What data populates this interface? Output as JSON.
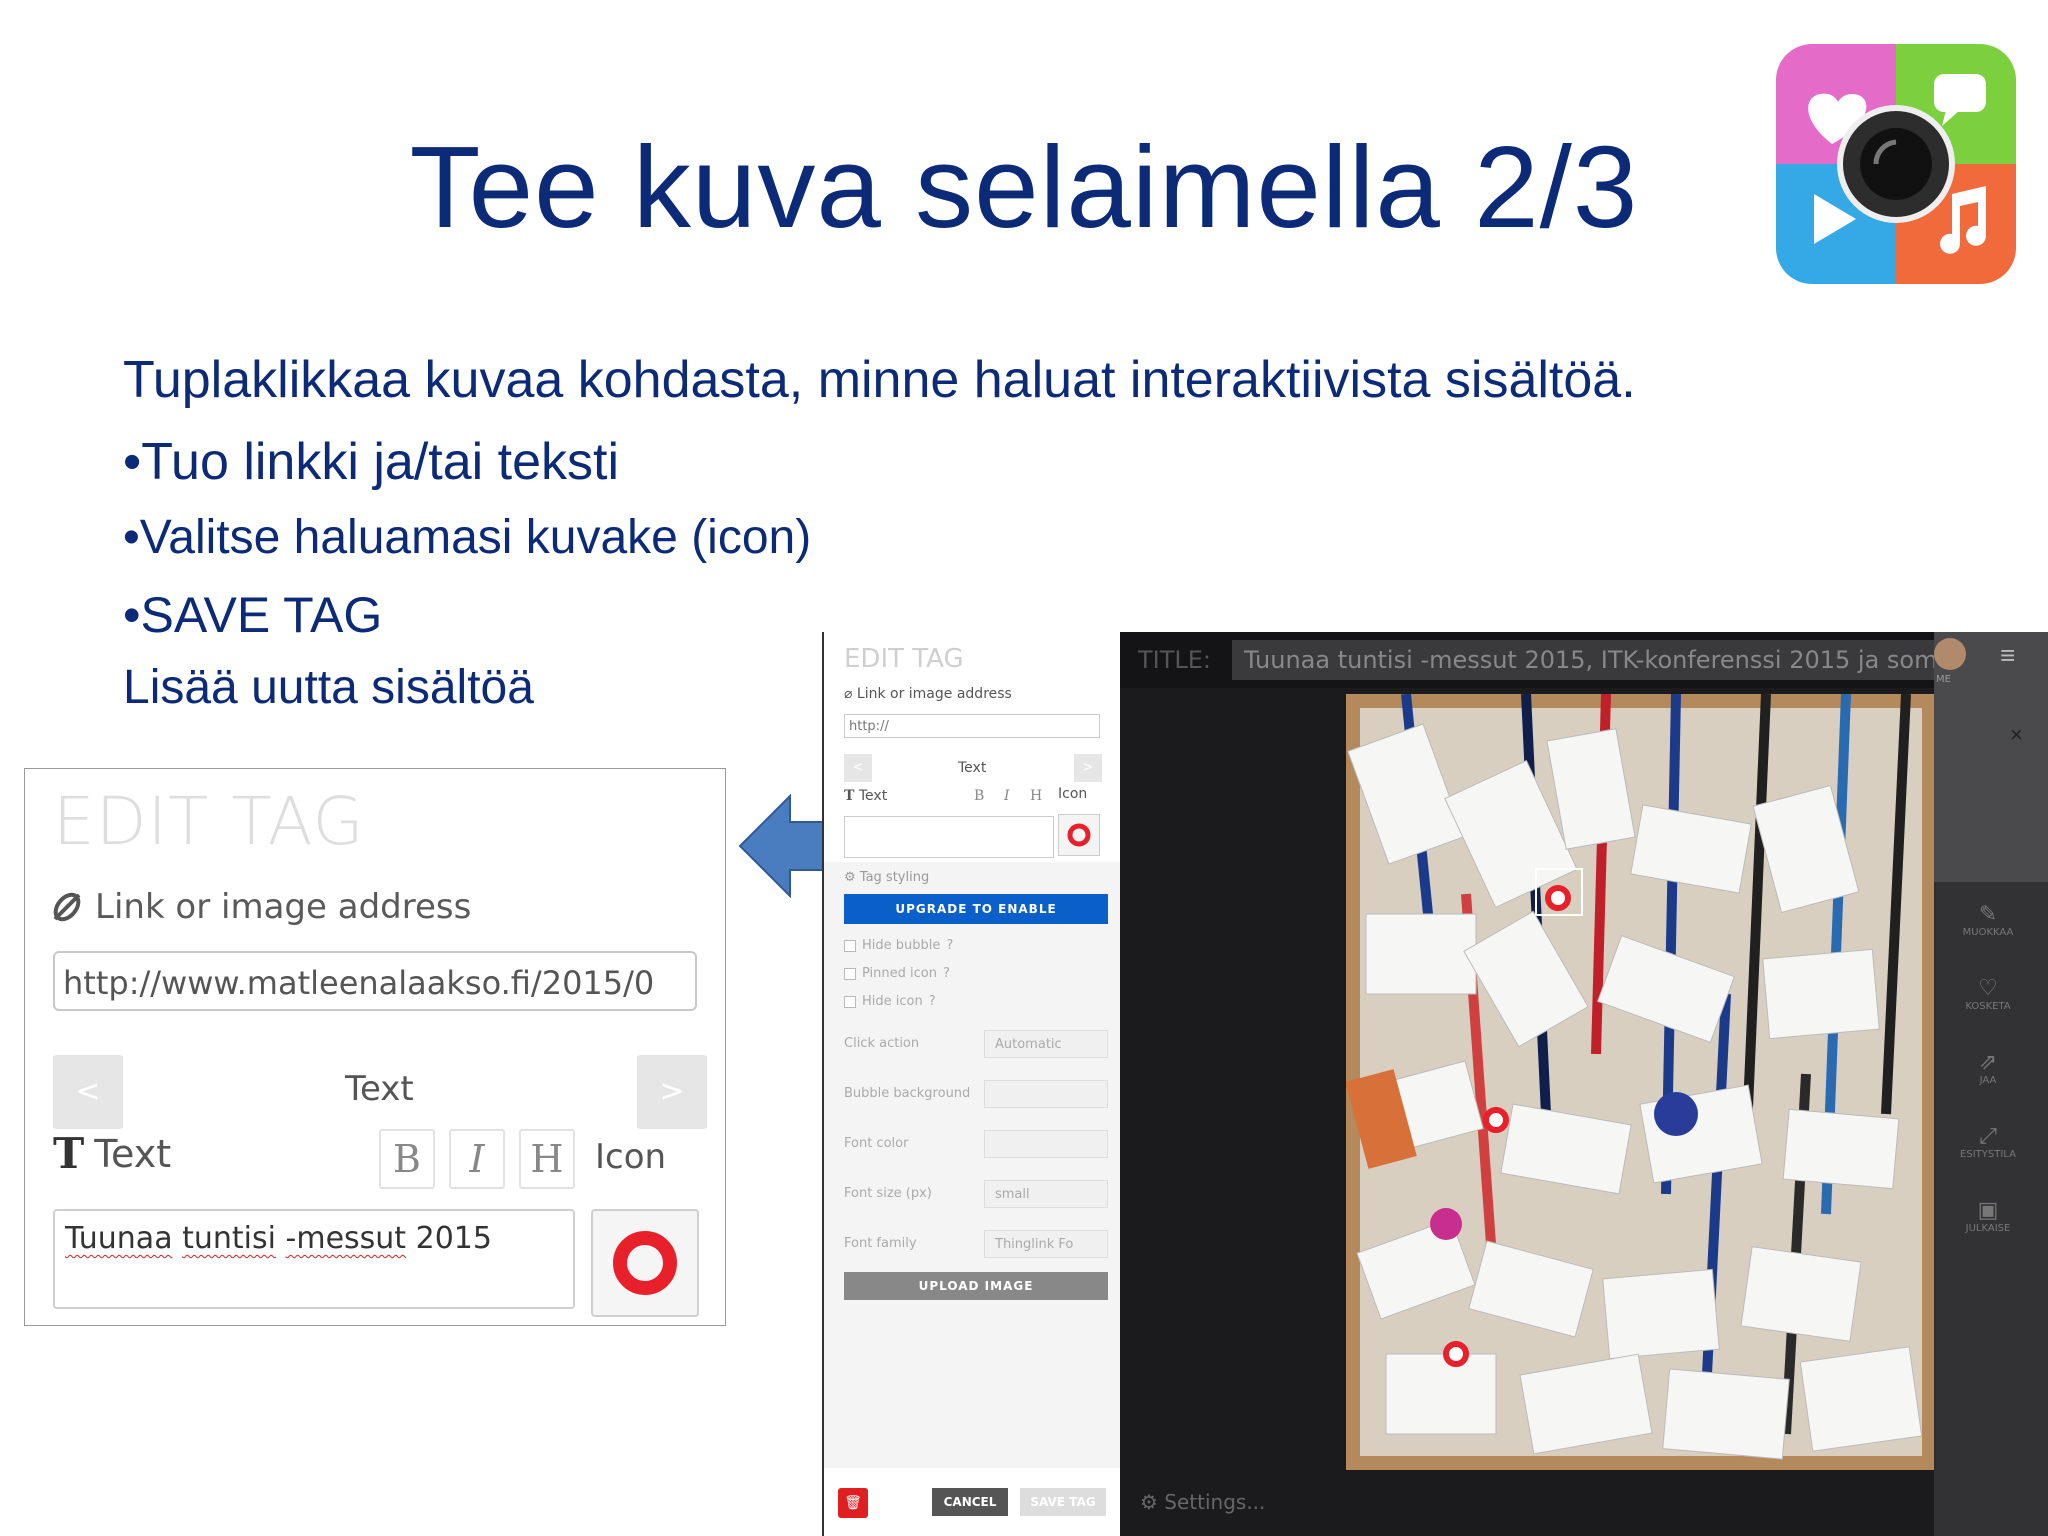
{
  "slide": {
    "title": "Tee kuva selaimella 2/3",
    "intro": "Tuplaklikkaa kuvaa kohdasta, minne haluat interaktiivista sisältöä.",
    "bullets": [
      "•Tuo linkki ja/tai teksti",
      "•Valitse haluamasi kuvake (icon)",
      "•SAVE TAG"
    ],
    "footer": "Lisää uutta sisältöä"
  },
  "zoom": {
    "title": "EDIT TAG",
    "link_label": "Link or image address",
    "url_value": "http://www.matleenalaakso.fi/2015/0",
    "prev": "<",
    "next": ">",
    "center_label": "Text",
    "text_label": "Text",
    "bold": "B",
    "italic": "I",
    "heading": "H",
    "icon_label": "Icon",
    "text_words": [
      "Tuunaa",
      "tuntisi",
      "-messut",
      "2015"
    ]
  },
  "panel": {
    "title": "EDIT TAG",
    "link_label": "Link or image address",
    "url_placeholder": "http://",
    "prev": "<",
    "next": ">",
    "center_label": "Text",
    "text_label": "Text",
    "bold": "B",
    "italic": "I",
    "heading": "H",
    "icon_label": "Icon",
    "tag_styling": "Tag styling",
    "upgrade": "UPGRADE TO ENABLE",
    "hide_bubble": "Hide bubble",
    "pinned_icon": "Pinned icon",
    "hide_icon": "Hide icon",
    "click_action": "Click action",
    "click_action_value": "Automatic",
    "bubble_background": "Bubble background",
    "font_color": "Font color",
    "font_size": "Font size (px)",
    "font_size_value": "small",
    "font_family": "Font family",
    "font_family_value": "Thinglink Fo",
    "upload_image": "UPLOAD IMAGE",
    "cancel": "CANCEL",
    "save_tag": "SAVE TAG"
  },
  "canvas": {
    "title_label": "TITLE:",
    "title_value": "Tuunaa tuntisi -messut 2015, ITK-konferenssi 2015 ja som",
    "settings": "Settings...",
    "close": "×",
    "me": "ME"
  },
  "sidebar": {
    "items": [
      "MUOKKAA",
      "KOSKETA",
      "JAA",
      "ESITYSTILA",
      "JULKAISE"
    ]
  },
  "colors": {
    "title_blue": "#0b2a78",
    "upgrade_blue": "#0b5fc9",
    "tag_red": "#e8202a",
    "arrow_blue": "#4a7cc0"
  }
}
